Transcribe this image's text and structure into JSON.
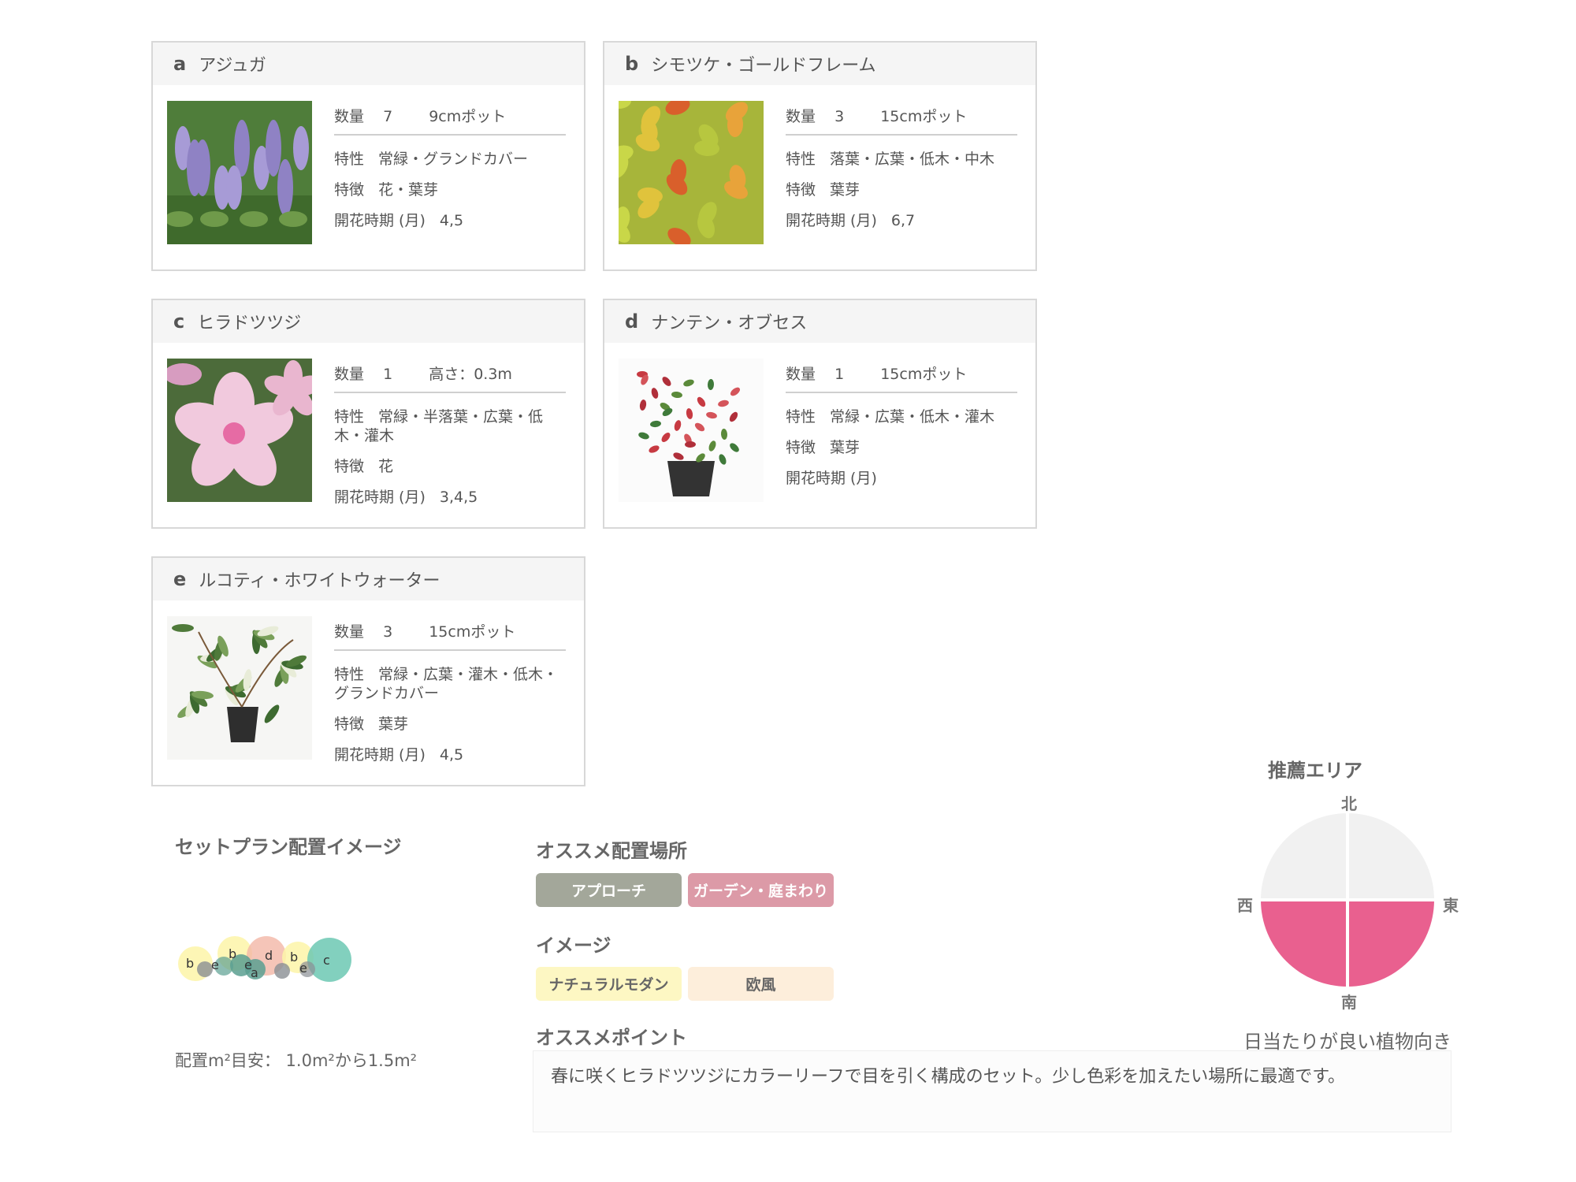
{
  "cards": [
    {
      "letter": "a",
      "name": "アジュガ",
      "qty_label": "数量",
      "qty": "7",
      "size": "9cmポット",
      "trait_label": "特性",
      "trait": "常緑・グランドカバー",
      "feature_label": "特徴",
      "feature": "花・葉芽",
      "bloom_label": "開花時期 (月)",
      "bloom": "4,5"
    },
    {
      "letter": "b",
      "name": "シモツケ・ゴールドフレーム",
      "qty_label": "数量",
      "qty": "3",
      "size": "15cmポット",
      "trait_label": "特性",
      "trait": "落葉・広葉・低木・中木",
      "feature_label": "特徴",
      "feature": "葉芽",
      "bloom_label": "開花時期 (月)",
      "bloom": "6,7"
    },
    {
      "letter": "c",
      "name": "ヒラドツツジ",
      "qty_label": "数量",
      "qty": "1",
      "size": "高さ：0.3m",
      "trait_label": "特性",
      "trait": "常緑・半落葉・広葉・低木・灌木",
      "feature_label": "特徴",
      "feature": "花",
      "bloom_label": "開花時期 (月)",
      "bloom": "3,4,5"
    },
    {
      "letter": "d",
      "name": "ナンテン・オブセス",
      "qty_label": "数量",
      "qty": "1",
      "size": "15cmポット",
      "trait_label": "特性",
      "trait": "常緑・広葉・低木・灌木",
      "feature_label": "特徴",
      "feature": "葉芽",
      "bloom_label": "開花時期 (月)",
      "bloom": ""
    },
    {
      "letter": "e",
      "name": "ルコティ・ホワイトウォーター",
      "qty_label": "数量",
      "qty": "3",
      "size": "15cmポット",
      "trait_label": "特性",
      "trait": "常緑・広葉・灌木・低木・グランドカバー",
      "feature_label": "特徴",
      "feature": "葉芽",
      "bloom_label": "開花時期 (月)",
      "bloom": "4,5"
    }
  ],
  "layout_section": {
    "title": "セットプラン配置イメージ",
    "area_note": "配置m²目安： 1.0m²から1.5m²",
    "bubble_letters": [
      "b",
      "e",
      "b",
      "e",
      "a",
      "d",
      "b",
      "e",
      "c"
    ]
  },
  "placement": {
    "title": "オススメ配置場所",
    "tags": [
      {
        "label": "アプローチ",
        "bg": "#a3a79a",
        "fg": "#ffffff"
      },
      {
        "label": "ガーデン・庭まわり",
        "bg": "#dc9aa7",
        "fg": "#ffffff"
      }
    ]
  },
  "image": {
    "title": "イメージ",
    "tags": [
      {
        "label": "ナチュラルモダン",
        "bg": "#fdf7c3",
        "fg": "#666666"
      },
      {
        "label": "欧風",
        "bg": "#fdeedb",
        "fg": "#666666"
      }
    ]
  },
  "point": {
    "title": "オススメポイント",
    "text": "春に咲くヒラドツツジにカラーリーフで目を引く構成のセット。少し色彩を加えたい場所に最適です。"
  },
  "area": {
    "title": "推薦エリア",
    "north": "北",
    "south": "南",
    "east": "東",
    "west": "西",
    "caption": "日当たりが良い植物向き",
    "highlight_color": "#e9608f",
    "base_color": "#f1f1f1",
    "highlighted_quadrants": [
      "south-west",
      "south-east"
    ]
  }
}
